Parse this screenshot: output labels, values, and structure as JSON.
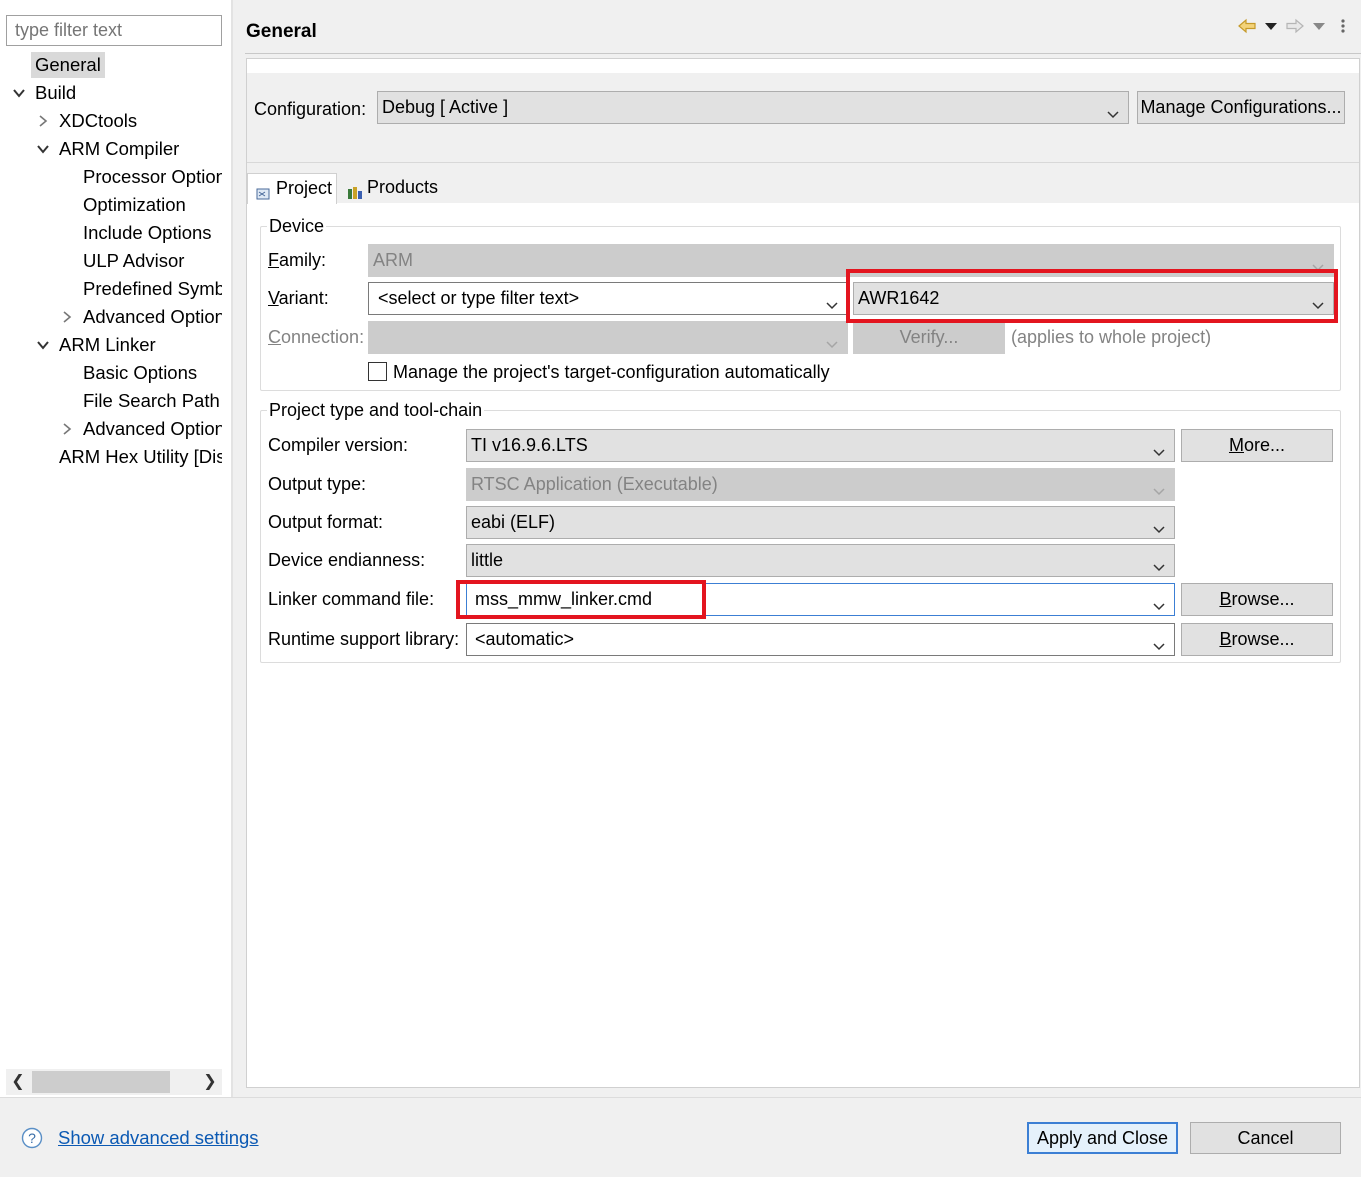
{
  "filter": {
    "placeholder": "type filter text"
  },
  "tree": [
    {
      "label": "General",
      "level": 0,
      "twisty": "none",
      "selected": true
    },
    {
      "label": "Build",
      "level": 0,
      "twisty": "expanded"
    },
    {
      "label": "XDCtools",
      "level": 1,
      "twisty": "collapsed"
    },
    {
      "label": "ARM Compiler",
      "level": 1,
      "twisty": "expanded"
    },
    {
      "label": "Processor Option",
      "level": 2,
      "twisty": "none"
    },
    {
      "label": "Optimization",
      "level": 2,
      "twisty": "none"
    },
    {
      "label": "Include Options",
      "level": 2,
      "twisty": "none"
    },
    {
      "label": "ULP Advisor",
      "level": 2,
      "twisty": "none"
    },
    {
      "label": "Predefined Symbo",
      "level": 2,
      "twisty": "none"
    },
    {
      "label": "Advanced Option",
      "level": 2,
      "twisty": "collapsed"
    },
    {
      "label": "ARM Linker",
      "level": 1,
      "twisty": "expanded"
    },
    {
      "label": "Basic Options",
      "level": 2,
      "twisty": "none"
    },
    {
      "label": "File Search Path",
      "level": 2,
      "twisty": "none"
    },
    {
      "label": "Advanced Option",
      "level": 2,
      "twisty": "collapsed"
    },
    {
      "label": "ARM Hex Utility  [Dis",
      "level": 1,
      "twisty": "none"
    }
  ],
  "page": {
    "title": "General"
  },
  "config": {
    "label": "Configuration:",
    "value": "Debug  [ Active ]",
    "manage_button": "Manage Configurations..."
  },
  "tabs": [
    {
      "label": "Project",
      "active": true
    },
    {
      "label": "Products",
      "active": false
    }
  ],
  "device": {
    "group_label": "Device",
    "family_label": "Family:",
    "family_value": "ARM",
    "variant_label": "Variant:",
    "variant_filter": "<select or type filter text>",
    "variant_value": "AWR1642",
    "connection_label": "Connection:",
    "connection_value": "",
    "verify_button": "Verify...",
    "applies_text": "(applies to whole project)",
    "manage_checkbox_label": "Manage the project's target-configuration automatically",
    "manage_checked": false
  },
  "toolchain": {
    "group_label": "Project type and tool-chain",
    "compiler_label": "Compiler version:",
    "compiler_value": "TI v16.9.6.LTS",
    "more_button": "More...",
    "output_type_label": "Output type:",
    "output_type_value": "RTSC Application (Executable)",
    "output_format_label": "Output format:",
    "output_format_value": "eabi (ELF)",
    "endianness_label": "Device endianness:",
    "endianness_value": "little",
    "linker_label": "Linker command file:",
    "linker_value": "mss_mmw_linker.cmd",
    "browse1": "Browse...",
    "runtime_label": "Runtime support library:",
    "runtime_value": "<automatic>",
    "browse2": "Browse..."
  },
  "bottom": {
    "advanced_link": "Show advanced settings",
    "apply_button": "Apply and Close",
    "cancel_button": "Cancel"
  },
  "colors": {
    "highlight": "#e3151f",
    "link": "#0b59b3",
    "focus": "#3c7fd4"
  }
}
